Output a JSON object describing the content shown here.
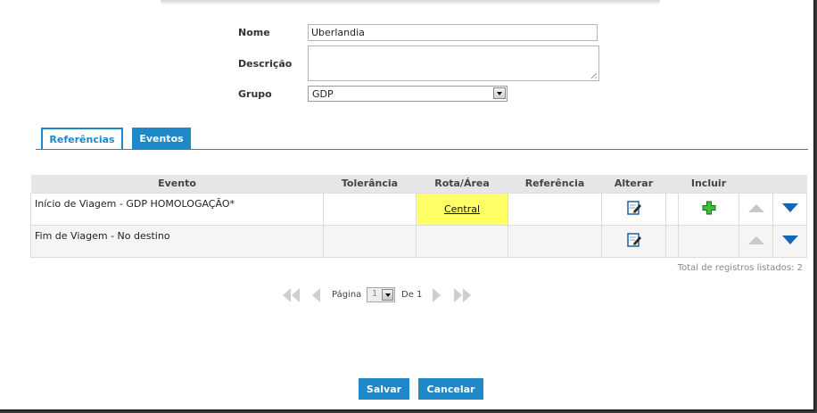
{
  "form": {
    "nome_label": "Nome",
    "nome_value": "Uberlandia",
    "descricao_label": "Descrição",
    "descricao_value": "",
    "grupo_label": "Grupo",
    "grupo_value": "GDP"
  },
  "tabs": [
    {
      "label": "Referências",
      "active": false
    },
    {
      "label": "Eventos",
      "active": true
    }
  ],
  "table": {
    "headers": [
      "Evento",
      "Tolerância",
      "Rota/Área",
      "Referência",
      "Alterar",
      "Incluir"
    ],
    "rows": [
      {
        "evento": "Início de Viagem - GDP HOMOLOGAÇÃO*",
        "tolerancia": "",
        "rota": "Central",
        "referencia": ""
      },
      {
        "evento": "Fim de Viagem - No destino",
        "tolerancia": "",
        "rota": "",
        "referencia": ""
      }
    ]
  },
  "total_text": "Total de registros listados: 2",
  "pager": {
    "pagina_label": "Página",
    "page_value": "1",
    "de_label": "De 1"
  },
  "buttons": {
    "save": "Salvar",
    "cancel": "Cancelar"
  },
  "colors": {
    "accent": "#1e88c8",
    "highlight": "#ffff66",
    "arrow_down": "#1565b8"
  },
  "icons": [
    "edit-icon",
    "plus-icon",
    "arrow-up-icon",
    "arrow-down-icon",
    "first-page-icon",
    "prev-page-icon",
    "next-page-icon",
    "last-page-icon"
  ]
}
